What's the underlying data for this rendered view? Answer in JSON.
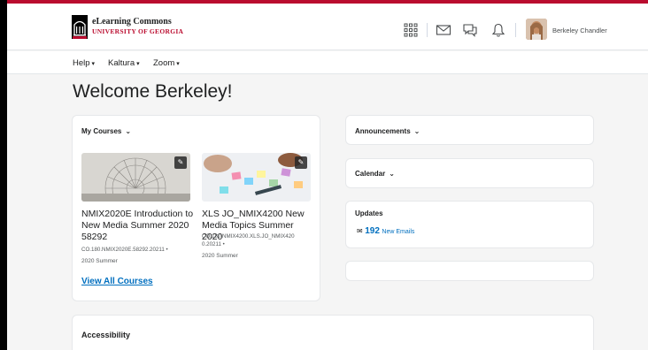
{
  "header": {
    "org_name": "eLearning Commons",
    "org_sub": "UNIVERSITY OF GEORGIA",
    "user_name": "Berkeley Chandler"
  },
  "nav": {
    "items": [
      {
        "label": "Help"
      },
      {
        "label": "Kaltura"
      },
      {
        "label": "Zoom"
      }
    ]
  },
  "page": {
    "welcome": "Welcome Berkeley!"
  },
  "my_courses": {
    "title": "My Courses",
    "courses": [
      {
        "name": "NMIX2020E Introduction to New Media Summer 2020 58292",
        "code": "CO.180.NMIX2020E.58292.20211",
        "semester": "2020 Summer"
      },
      {
        "name": "XLS JO_NMIX4200 New Media Topics Summer 2020",
        "code": "CO.180.NMIX4200.XLS.JO_NMIX420 0.20211",
        "semester": "2020 Summer"
      }
    ],
    "view_all": "View All Courses"
  },
  "widgets": {
    "announcements": "Announcements",
    "calendar": "Calendar",
    "updates": {
      "title": "Updates",
      "count": "192",
      "label": "New Emails"
    }
  },
  "accessibility": {
    "title": "Accessibility"
  },
  "icons": {
    "apps": "grid-icon",
    "mail": "envelope-icon",
    "chat": "chat-bubbles-icon",
    "notifications": "bell-icon"
  },
  "colors": {
    "brand_red": "#ba0c2f",
    "link_blue": "#006fbf"
  }
}
